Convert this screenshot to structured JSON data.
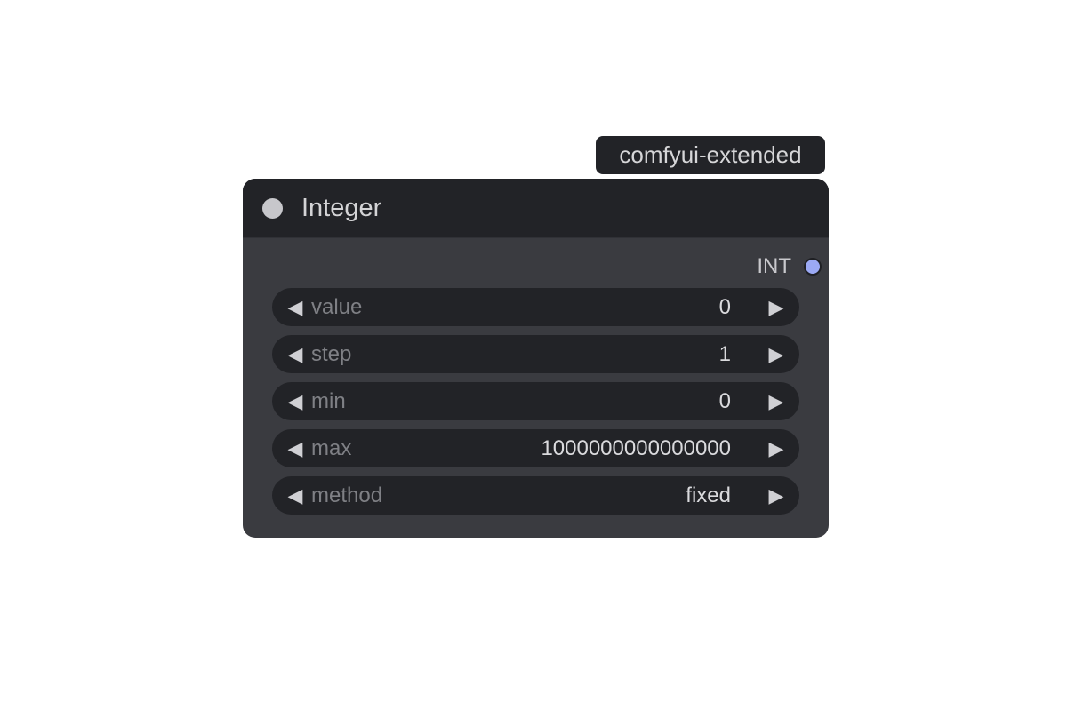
{
  "badge": {
    "text": "comfyui-extended"
  },
  "node": {
    "title": "Integer",
    "output": {
      "label": "INT",
      "color": "#9ba9f4"
    },
    "widgets": [
      {
        "label": "value",
        "value": "0"
      },
      {
        "label": "step",
        "value": "1"
      },
      {
        "label": "min",
        "value": "0"
      },
      {
        "label": "max",
        "value": "1000000000000000"
      },
      {
        "label": "method",
        "value": "fixed"
      }
    ]
  },
  "icons": {
    "decrement": "◀",
    "increment": "▶",
    "collapse": "circle-dot-icon",
    "output_slot": "output-slot-icon"
  },
  "colors": {
    "node_body": "#3a3b40",
    "node_header": "#222327",
    "widget_bg": "#222327"
  }
}
